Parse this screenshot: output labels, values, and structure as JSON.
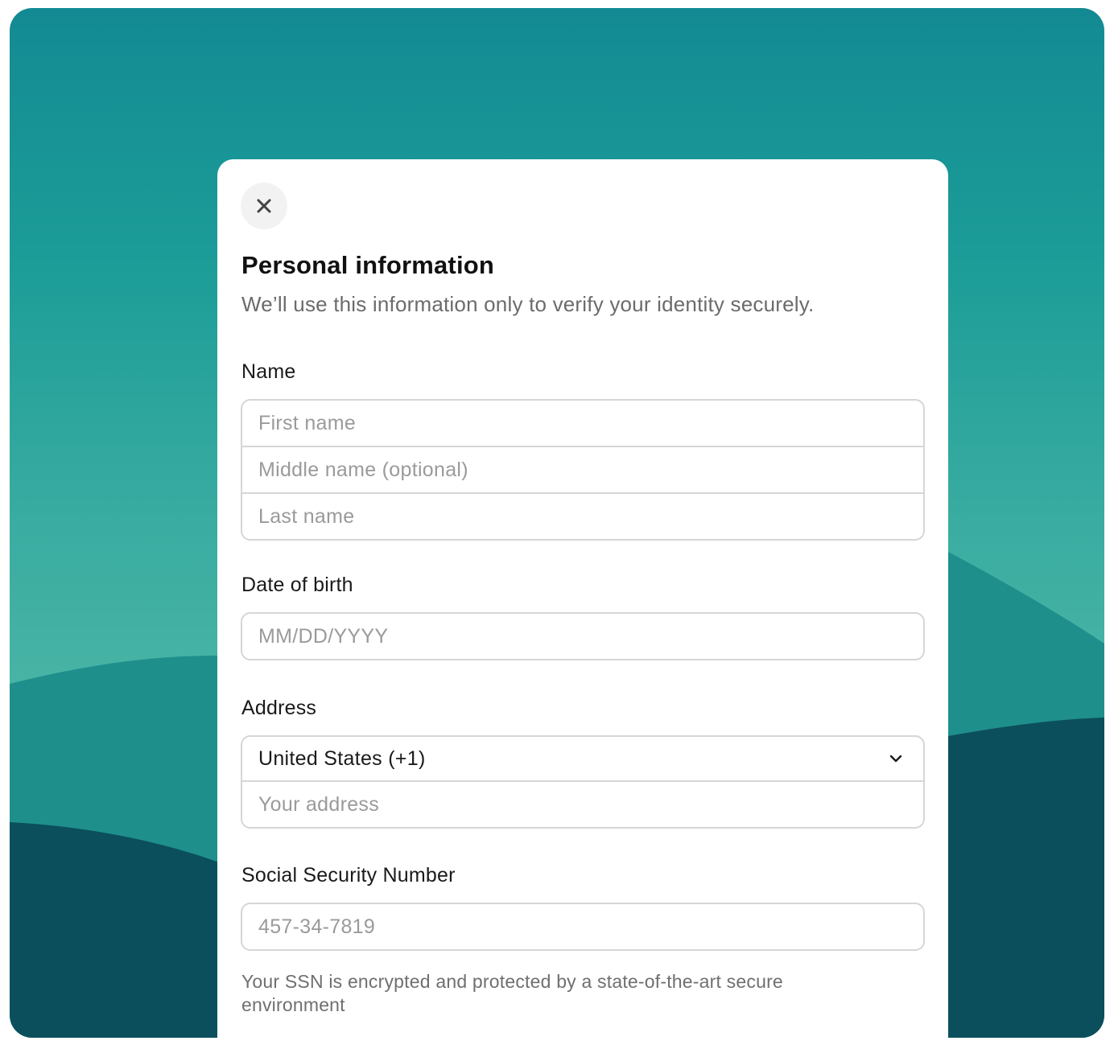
{
  "colors": {
    "background_teal": "#1a9598",
    "hill_mid": "#1f8f8c",
    "hill_dark": "#0b4f5c",
    "card": "#ffffff",
    "border": "#d6d6d6"
  },
  "dialog": {
    "close_icon": "close-icon",
    "title": "Personal information",
    "subtitle": "We’ll use this information only to verify your identity securely."
  },
  "name_section": {
    "label": "Name",
    "first_name_placeholder": "First name",
    "middle_name_placeholder": "Middle name (optional)",
    "last_name_placeholder": "Last name"
  },
  "dob_section": {
    "label": "Date of birth",
    "placeholder": "MM/DD/YYYY"
  },
  "address_section": {
    "label": "Address",
    "country_selected": "United States (+1)",
    "chevron_icon": "chevron-down-icon",
    "address_placeholder": "Your address"
  },
  "ssn_section": {
    "label": "Social Security Number",
    "placeholder": "457-34-7819",
    "helper_text": "Your SSN is encrypted and protected by a state-of-the-art secure environment"
  }
}
